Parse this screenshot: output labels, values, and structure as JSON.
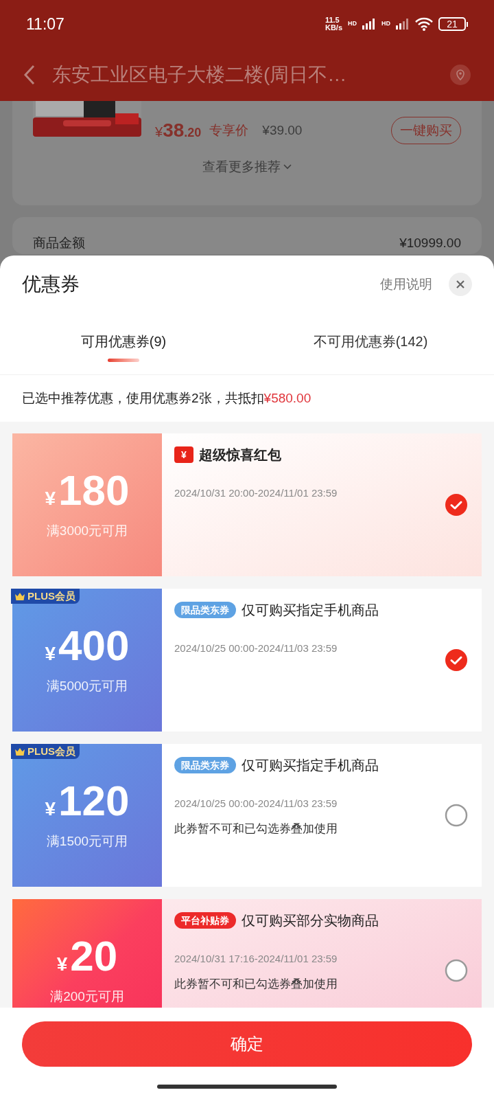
{
  "status_bar": {
    "time": "11:07",
    "speed_value": "11.5",
    "speed_unit": "KB/s",
    "network_1": "HD",
    "network_2": "HD",
    "battery": "21"
  },
  "header": {
    "title": "东安工业区电子大楼二楼(周日不…"
  },
  "background_page": {
    "price_symbol": "¥",
    "price_int": "38",
    "price_dec": ".20",
    "price_label": "专享价",
    "original_price": "¥39.00",
    "buy_button": "一键购买",
    "more_link": "查看更多推荐",
    "amount_label": "商品金额",
    "amount_value": "¥10999.00"
  },
  "sheet": {
    "title": "优惠券",
    "help_link": "使用说明",
    "tabs": [
      {
        "label": "可用优惠券(9)",
        "selected": true
      },
      {
        "label": "不可用优惠券(142)",
        "selected": false
      }
    ],
    "summary": "已选中推荐优惠，使用优惠券2张，共抵扣",
    "summary_amount": "¥580.00",
    "coupons": [
      {
        "kind": "red_packet",
        "currency": "¥",
        "amount": "180",
        "condition": "满3000元可用",
        "tag_icon": "¥",
        "title": "超级惊喜红包",
        "period": "2024/10/31 20:00-2024/11/01 23:59",
        "selected": true
      },
      {
        "kind": "plus",
        "badge": "PLUS会员",
        "currency": "¥",
        "amount": "400",
        "condition": "满5000元可用",
        "tag": "限品类东券",
        "title": "仅可购买指定手机商品",
        "period": "2024/10/25 00:00-2024/11/03 23:59",
        "selected": true
      },
      {
        "kind": "plus",
        "badge": "PLUS会员",
        "currency": "¥",
        "amount": "120",
        "condition": "满1500元可用",
        "tag": "限品类东券",
        "title": "仅可购买指定手机商品",
        "period": "2024/10/25 00:00-2024/11/03 23:59",
        "note": "此券暂不可和已勾选券叠加使用",
        "selected": false
      },
      {
        "kind": "subsidy",
        "currency": "¥",
        "amount": "20",
        "condition": "满200元可用",
        "tag": "平台补贴券",
        "title": "仅可购买部分实物商品",
        "period": "2024/10/31 17:16-2024/11/01 23:59",
        "note": "此券暂不可和已勾选券叠加使用",
        "selected": false
      }
    ],
    "confirm_button": "确定"
  }
}
